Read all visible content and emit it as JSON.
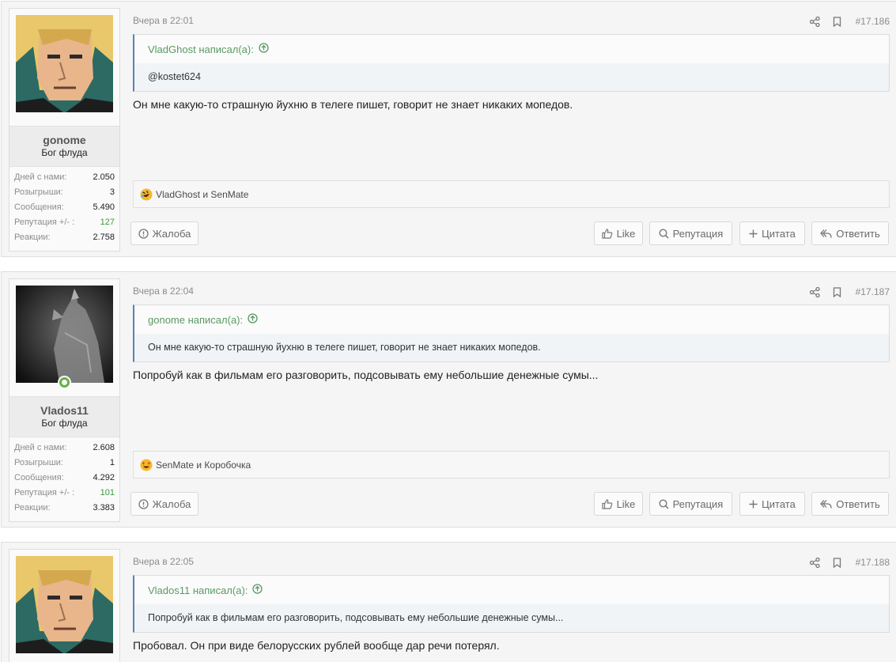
{
  "posts": [
    {
      "user": {
        "name": "gonome",
        "title": "Бог флуда",
        "avatar": "anime-character-avatar",
        "online": false
      },
      "stats": [
        {
          "label": "Дней с нами:",
          "value": "2.050"
        },
        {
          "label": "Розыгрыши:",
          "value": "3"
        },
        {
          "label": "Сообщения:",
          "value": "5.490"
        },
        {
          "label": "Репутация +/- :",
          "value": "127"
        },
        {
          "label": "Реакции:",
          "value": "2.758"
        }
      ],
      "date": "Вчера в 22:01",
      "number": "#17.186",
      "quote": {
        "author": "VladGhost написал(а):",
        "text": "@kostet624"
      },
      "text": "Он мне какую-то страшную йухню в телеге пишет, говорит не знает никаких мопедов.",
      "reactions": {
        "emoji": "rofl-emoji",
        "text": "VladGhost и SenMate"
      },
      "buttons": {
        "report": "Жалоба",
        "like": "Like",
        "rep": "Репутация",
        "quote": "Цитата",
        "reply": "Ответить"
      }
    },
    {
      "user": {
        "name": "Vlados11",
        "title": "Бог флуда",
        "avatar": "wolf-avatar",
        "online": true
      },
      "stats": [
        {
          "label": "Дней с нами:",
          "value": "2.608"
        },
        {
          "label": "Розыгрыши:",
          "value": "1"
        },
        {
          "label": "Сообщения:",
          "value": "4.292"
        },
        {
          "label": "Репутация +/- :",
          "value": "101"
        },
        {
          "label": "Реакции:",
          "value": "3.383"
        }
      ],
      "date": "Вчера в 22:04",
      "number": "#17.187",
      "quote": {
        "author": "gonome написал(а):",
        "text": "Он мне какую-то страшную йухню в телеге пишет, говорит не знает никаких мопедов."
      },
      "text": "Попробуй как в фильмам его разговорить, подсовывать ему небольшие денежные сумы...",
      "reactions": {
        "emoji": "heart-eyes-emoji",
        "text": "SenMate и Коробочка"
      },
      "buttons": {
        "report": "Жалоба",
        "like": "Like",
        "rep": "Репутация",
        "quote": "Цитата",
        "reply": "Ответить"
      }
    },
    {
      "user": {
        "avatar": "anime-character-avatar"
      },
      "date": "Вчера в 22:05",
      "number": "#17.188",
      "quote": {
        "author": "Vlados11 написал(а):",
        "text": "Попробуй как в фильмам его разговорить, подсовывать ему небольшие денежные сумы..."
      },
      "text": "Пробовал. Он при виде белорусских рублей вообще дар речи потерял."
    }
  ],
  "colors": {
    "reputation": "#3c9a3c",
    "quote_author": "#5a9a62",
    "online": "#63b246"
  }
}
